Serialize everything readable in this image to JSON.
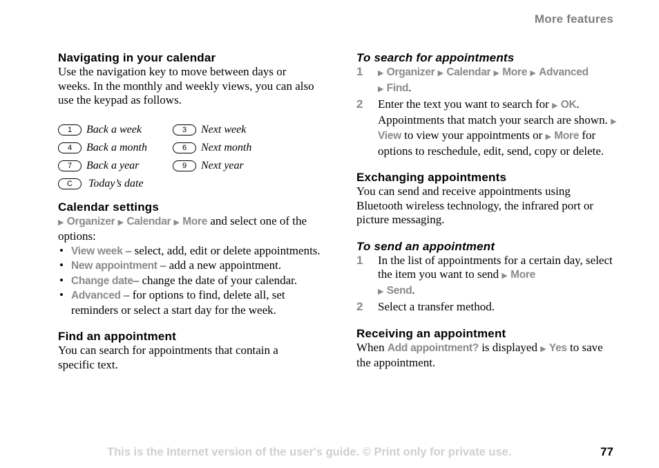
{
  "header": {
    "title": "More features"
  },
  "left": {
    "nav_heading": "Navigating in your calendar",
    "nav_text": "Use the navigation key to move between days or weeks. In the monthly and weekly views, you can also use the keypad as follows.",
    "keys": [
      {
        "key": "1",
        "label": "Back a week"
      },
      {
        "key": "3",
        "label": "Next week"
      },
      {
        "key": "4",
        "label": "Back a month"
      },
      {
        "key": "6",
        "label": "Next month"
      },
      {
        "key": "7",
        "label": "Back a year"
      },
      {
        "key": "9",
        "label": "Next year"
      },
      {
        "key": "C",
        "label": "Today’s date"
      }
    ],
    "settings_heading": "Calendar settings",
    "settings_path": [
      "Organizer",
      "Calendar",
      "More"
    ],
    "settings_text": " and select one of the options:",
    "options": [
      {
        "name": "View week",
        "desc": " – select, add, edit or delete appointments."
      },
      {
        "name": "New appointment",
        "desc": " – add a new appointment."
      },
      {
        "name": "Change date",
        "desc": "– change the date of your calendar."
      },
      {
        "name": "Advanced",
        "desc": " – for options to find, delete all, set reminders or select a start day for the week."
      }
    ],
    "find_heading": "Find an appointment",
    "find_text": "You can search for appointments that contain a specific text."
  },
  "right": {
    "search_heading": "To search for appointments",
    "search_step1_path": [
      "Organizer",
      "Calendar",
      "More",
      "Advanced",
      "Find"
    ],
    "search_step2_a": "Enter the text you want to search for ",
    "search_step2_ok": "OK",
    "search_step2_b": ". Appointments that match your search are shown. ",
    "search_step2_view": "View",
    "search_step2_c": " to view your appointments or ",
    "search_step2_more": "More",
    "search_step2_d": " for options to reschedule, edit, send, copy or delete.",
    "exchange_heading": "Exchanging appointments",
    "exchange_text": "You can send and receive appointments using Bluetooth wireless technology, the infrared port or picture messaging.",
    "send_heading": "To send an appointment",
    "send_step1_text": "In the list of appointments for a certain day, select the item you want to send ",
    "send_step1_more": "More",
    "send_step1_send": "Send",
    "send_step2_text": "Select a transfer method.",
    "receive_heading": "Receiving an appointment",
    "receive_a": "When ",
    "receive_prompt": "Add appointment?",
    "receive_b": " is displayed ",
    "receive_yes": "Yes",
    "receive_c": " to save the appointment."
  },
  "steps": {
    "one": "1",
    "two": "2"
  },
  "symbols": {
    "arrow": "▶",
    "bullet": "•",
    "period": "."
  },
  "footer": {
    "notice": "This is the Internet version of the user's guide. © Print only for private use.",
    "page_number": "77"
  }
}
